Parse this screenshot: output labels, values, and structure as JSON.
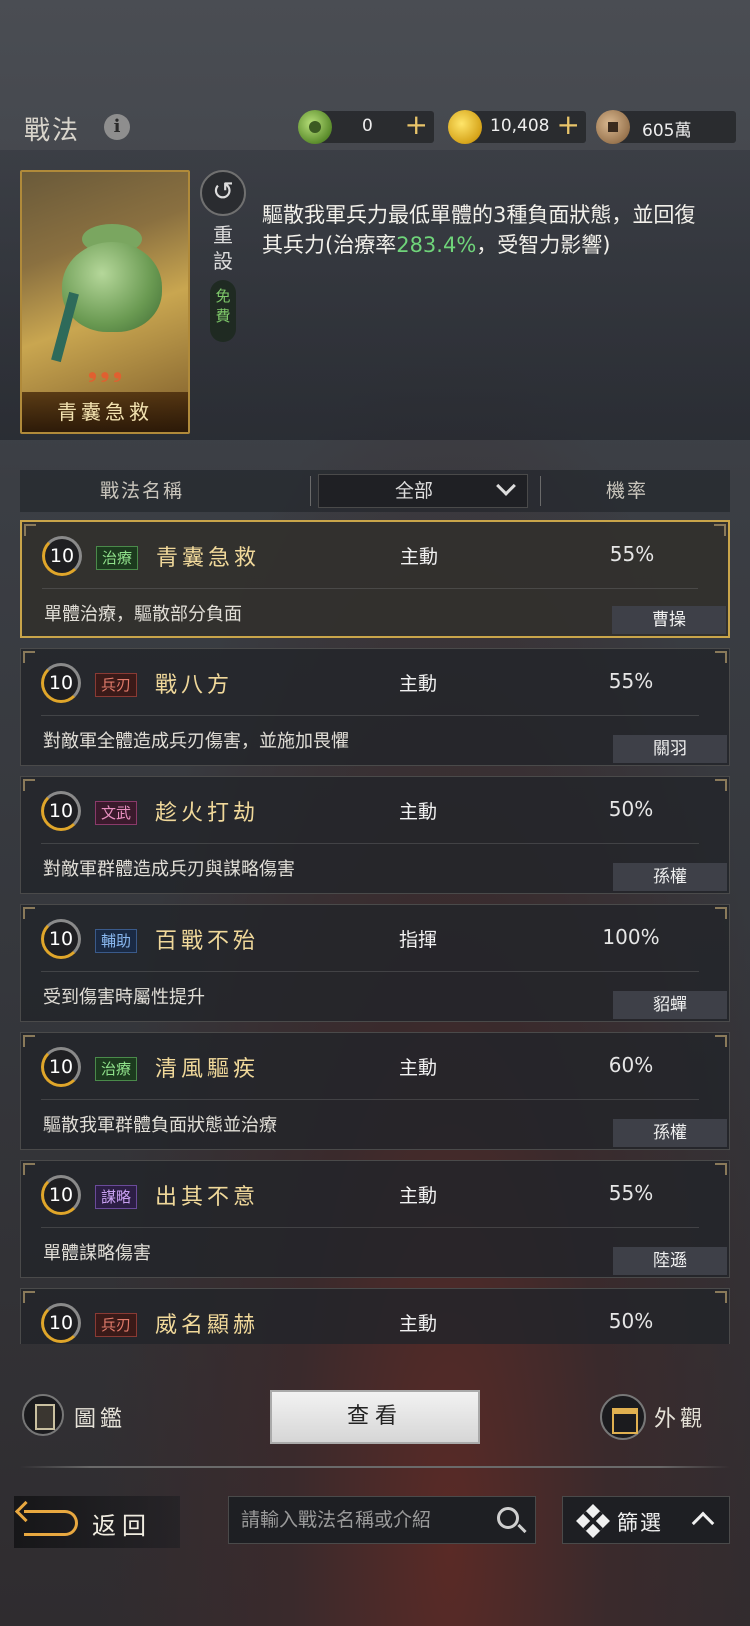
{
  "header": {
    "title": "戰法",
    "currencies": [
      {
        "icon": "jade-coin-icon",
        "value": "0",
        "has_plus": true
      },
      {
        "icon": "gold-coin-icon",
        "value": "10,408",
        "has_plus": true
      },
      {
        "icon": "copper-coin-icon",
        "value": "605萬",
        "has_plus": false
      }
    ]
  },
  "detail": {
    "card_name": "青囊急救",
    "reset_label": "重設",
    "free_label": "免費",
    "desc_before": "驅散我軍兵力最低單體的3種負面狀態，並回復其兵力(治療率",
    "desc_highlight": "283.4%",
    "desc_after": "，受智力影響)",
    "highlight_color": "#6fd47a"
  },
  "table": {
    "col_name": "戰法名稱",
    "filter_value": "全部",
    "col_rate": "機率"
  },
  "skills": [
    {
      "level": "10",
      "tag": "治療",
      "tag_kind": "heal",
      "name": "青囊急救",
      "type": "主動",
      "rate": "55%",
      "desc": "單體治療，驅散部分負面",
      "hero": "曹操",
      "selected": true
    },
    {
      "level": "10",
      "tag": "兵刃",
      "tag_kind": "blade",
      "name": "戰八方",
      "type": "主動",
      "rate": "55%",
      "desc": "對敵軍全體造成兵刃傷害，並施加畏懼",
      "hero": "關羽",
      "selected": false
    },
    {
      "level": "10",
      "tag": "文武",
      "tag_kind": "civil",
      "name": "趁火打劫",
      "type": "主動",
      "rate": "50%",
      "desc": "對敵軍群體造成兵刃與謀略傷害",
      "hero": "孫權",
      "selected": false
    },
    {
      "level": "10",
      "tag": "輔助",
      "tag_kind": "aux",
      "name": "百戰不殆",
      "type": "指揮",
      "rate": "100%",
      "desc": "受到傷害時屬性提升",
      "hero": "貂蟬",
      "selected": false
    },
    {
      "level": "10",
      "tag": "治療",
      "tag_kind": "heal",
      "name": "清風驅疾",
      "type": "主動",
      "rate": "60%",
      "desc": "驅散我軍群體負面狀態並治療",
      "hero": "孫權",
      "selected": false
    },
    {
      "level": "10",
      "tag": "謀略",
      "tag_kind": "plot",
      "name": "出其不意",
      "type": "主動",
      "rate": "55%",
      "desc": "單體謀略傷害",
      "hero": "陸遜",
      "selected": false
    },
    {
      "level": "10",
      "tag": "兵刃",
      "tag_kind": "blade",
      "name": "威名顯赫",
      "type": "主動",
      "rate": "50%",
      "desc": "",
      "hero": "",
      "selected": false
    }
  ],
  "footer": {
    "atlas_label": "圖鑑",
    "view_label": "查看",
    "appearance_label": "外觀",
    "back_label": "返回",
    "search_placeholder": "請輸入戰法名稱或介紹",
    "filter_label": "篩選"
  }
}
